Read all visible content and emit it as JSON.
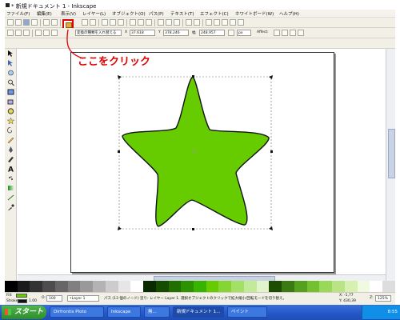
{
  "window": {
    "title": "* 新規ドキュメント 1 - Inkscape"
  },
  "menu": [
    "ファイル(F)",
    "編集(E)",
    "表示(V)",
    "レイヤー(L)",
    "オブジェクト(O)",
    "パス(P)",
    "テキスト(T)",
    "エフェクト(C)",
    "ホワイトボード(W)",
    "ヘルプ(H)"
  ],
  "toolbar": {
    "mode_field": "変換の種類を入れ替える",
    "x_label": "X",
    "x_value": "37.618",
    "y_label": "Y",
    "y_value": "378.246",
    "w_label": "幅",
    "w_value": "248.957",
    "unit": "px",
    "affect_label": "Affect:"
  },
  "callout": {
    "text": "ここをクリック"
  },
  "status": {
    "fill_label": "Fill:",
    "stroke_label": "Stroke:",
    "stroke_width": "1.00",
    "opacity_label": "O:",
    "opacity_value": "100",
    "layer": "•Layer 1",
    "message": "パス (13 個のノード) 塗り: レイヤー Layer 1. 選択オブジェクトのクリックで拡大縮小/回転モードを切り替え。",
    "coord_x": "X: -1,77",
    "coord_y": "Y: 430,39",
    "zoom_label": "Z:",
    "zoom_value": "125%"
  },
  "taskbar": {
    "start_label": "スタート",
    "tasks": [
      "Dirfrontis Ploto",
      "Inkscape",
      "無...",
      "新規ドキュメント 1...",
      "ペイント"
    ],
    "clock": "8:55"
  },
  "colors": {
    "star_fill": "#66cc00",
    "accent": "#e00000"
  },
  "icons": [
    "select-arrow-icon",
    "node-edit-icon",
    "zoom-icon",
    "rectangle-icon",
    "ellipse-icon",
    "star-icon",
    "spiral-icon",
    "pencil-icon",
    "pen-icon",
    "calligraphy-icon",
    "text-icon",
    "gradient-icon",
    "dropper-icon"
  ]
}
